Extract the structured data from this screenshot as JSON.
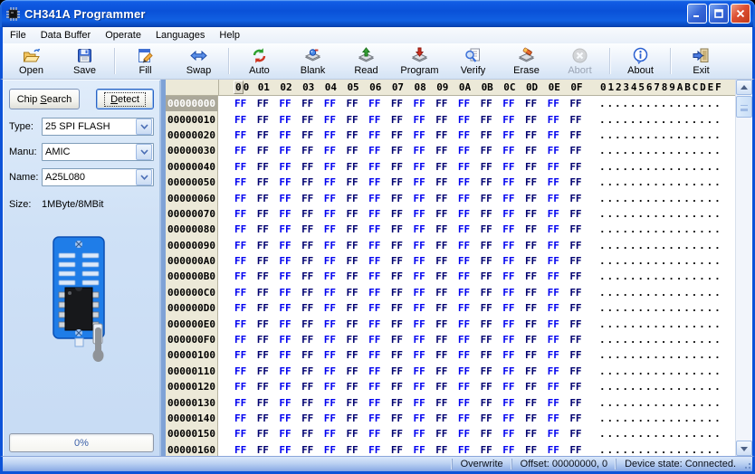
{
  "window": {
    "title": "CH341A Programmer"
  },
  "menu": {
    "items": [
      "File",
      "Data Buffer",
      "Operate",
      "Languages",
      "Help"
    ]
  },
  "toolbar": {
    "buttons": [
      {
        "label": "Open",
        "icon": "open-icon",
        "enabled": true,
        "group_end": false
      },
      {
        "label": "Save",
        "icon": "save-icon",
        "enabled": true,
        "group_end": true
      },
      {
        "label": "Fill",
        "icon": "fill-icon",
        "enabled": true,
        "group_end": false
      },
      {
        "label": "Swap",
        "icon": "swap-icon",
        "enabled": true,
        "group_end": true
      },
      {
        "label": "Auto",
        "icon": "auto-icon",
        "enabled": true,
        "group_end": false
      },
      {
        "label": "Blank",
        "icon": "blank-icon",
        "enabled": true,
        "group_end": false
      },
      {
        "label": "Read",
        "icon": "read-icon",
        "enabled": true,
        "group_end": false
      },
      {
        "label": "Program",
        "icon": "program-icon",
        "enabled": true,
        "group_end": false
      },
      {
        "label": "Verify",
        "icon": "verify-icon",
        "enabled": true,
        "group_end": false
      },
      {
        "label": "Erase",
        "icon": "erase-icon",
        "enabled": true,
        "group_end": false
      },
      {
        "label": "Abort",
        "icon": "abort-icon",
        "enabled": false,
        "group_end": true
      },
      {
        "label": "About",
        "icon": "about-icon",
        "enabled": true,
        "group_end": true
      },
      {
        "label": "Exit",
        "icon": "exit-icon",
        "enabled": true,
        "group_end": false
      }
    ]
  },
  "left_panel": {
    "chip_search_button": "Chip Search",
    "chip_search_accel": "S",
    "detect_button": "Detect",
    "detect_accel": "D",
    "fields": [
      {
        "label": "Type:",
        "value": "25 SPI FLASH"
      },
      {
        "label": "Manu:",
        "value": "AMIC"
      },
      {
        "label": "Name:",
        "value": "A25L080"
      }
    ],
    "size_label": "Size:",
    "size_value": "1MByte/8MBit",
    "progress": "0%"
  },
  "hex_editor": {
    "column_headers": [
      "00",
      "01",
      "02",
      "03",
      "04",
      "05",
      "06",
      "07",
      "08",
      "09",
      "0A",
      "0B",
      "0C",
      "0D",
      "0E",
      "0F"
    ],
    "ascii_header": "0123456789ABCDEF",
    "rows": [
      {
        "addr": "00000000",
        "selected": true,
        "bytes": [
          "FF",
          "FF",
          "FF",
          "FF",
          "FF",
          "FF",
          "FF",
          "FF",
          "FF",
          "FF",
          "FF",
          "FF",
          "FF",
          "FF",
          "FF",
          "FF"
        ],
        "ascii": "................"
      },
      {
        "addr": "00000010",
        "selected": false,
        "bytes": [
          "FF",
          "FF",
          "FF",
          "FF",
          "FF",
          "FF",
          "FF",
          "FF",
          "FF",
          "FF",
          "FF",
          "FF",
          "FF",
          "FF",
          "FF",
          "FF"
        ],
        "ascii": "................"
      },
      {
        "addr": "00000020",
        "selected": false,
        "bytes": [
          "FF",
          "FF",
          "FF",
          "FF",
          "FF",
          "FF",
          "FF",
          "FF",
          "FF",
          "FF",
          "FF",
          "FF",
          "FF",
          "FF",
          "FF",
          "FF"
        ],
        "ascii": "................"
      },
      {
        "addr": "00000030",
        "selected": false,
        "bytes": [
          "FF",
          "FF",
          "FF",
          "FF",
          "FF",
          "FF",
          "FF",
          "FF",
          "FF",
          "FF",
          "FF",
          "FF",
          "FF",
          "FF",
          "FF",
          "FF"
        ],
        "ascii": "................"
      },
      {
        "addr": "00000040",
        "selected": false,
        "bytes": [
          "FF",
          "FF",
          "FF",
          "FF",
          "FF",
          "FF",
          "FF",
          "FF",
          "FF",
          "FF",
          "FF",
          "FF",
          "FF",
          "FF",
          "FF",
          "FF"
        ],
        "ascii": "................"
      },
      {
        "addr": "00000050",
        "selected": false,
        "bytes": [
          "FF",
          "FF",
          "FF",
          "FF",
          "FF",
          "FF",
          "FF",
          "FF",
          "FF",
          "FF",
          "FF",
          "FF",
          "FF",
          "FF",
          "FF",
          "FF"
        ],
        "ascii": "................"
      },
      {
        "addr": "00000060",
        "selected": false,
        "bytes": [
          "FF",
          "FF",
          "FF",
          "FF",
          "FF",
          "FF",
          "FF",
          "FF",
          "FF",
          "FF",
          "FF",
          "FF",
          "FF",
          "FF",
          "FF",
          "FF"
        ],
        "ascii": "................"
      },
      {
        "addr": "00000070",
        "selected": false,
        "bytes": [
          "FF",
          "FF",
          "FF",
          "FF",
          "FF",
          "FF",
          "FF",
          "FF",
          "FF",
          "FF",
          "FF",
          "FF",
          "FF",
          "FF",
          "FF",
          "FF"
        ],
        "ascii": "................"
      },
      {
        "addr": "00000080",
        "selected": false,
        "bytes": [
          "FF",
          "FF",
          "FF",
          "FF",
          "FF",
          "FF",
          "FF",
          "FF",
          "FF",
          "FF",
          "FF",
          "FF",
          "FF",
          "FF",
          "FF",
          "FF"
        ],
        "ascii": "................"
      },
      {
        "addr": "00000090",
        "selected": false,
        "bytes": [
          "FF",
          "FF",
          "FF",
          "FF",
          "FF",
          "FF",
          "FF",
          "FF",
          "FF",
          "FF",
          "FF",
          "FF",
          "FF",
          "FF",
          "FF",
          "FF"
        ],
        "ascii": "................"
      },
      {
        "addr": "000000A0",
        "selected": false,
        "bytes": [
          "FF",
          "FF",
          "FF",
          "FF",
          "FF",
          "FF",
          "FF",
          "FF",
          "FF",
          "FF",
          "FF",
          "FF",
          "FF",
          "FF",
          "FF",
          "FF"
        ],
        "ascii": "................"
      },
      {
        "addr": "000000B0",
        "selected": false,
        "bytes": [
          "FF",
          "FF",
          "FF",
          "FF",
          "FF",
          "FF",
          "FF",
          "FF",
          "FF",
          "FF",
          "FF",
          "FF",
          "FF",
          "FF",
          "FF",
          "FF"
        ],
        "ascii": "................"
      },
      {
        "addr": "000000C0",
        "selected": false,
        "bytes": [
          "FF",
          "FF",
          "FF",
          "FF",
          "FF",
          "FF",
          "FF",
          "FF",
          "FF",
          "FF",
          "FF",
          "FF",
          "FF",
          "FF",
          "FF",
          "FF"
        ],
        "ascii": "................"
      },
      {
        "addr": "000000D0",
        "selected": false,
        "bytes": [
          "FF",
          "FF",
          "FF",
          "FF",
          "FF",
          "FF",
          "FF",
          "FF",
          "FF",
          "FF",
          "FF",
          "FF",
          "FF",
          "FF",
          "FF",
          "FF"
        ],
        "ascii": "................"
      },
      {
        "addr": "000000E0",
        "selected": false,
        "bytes": [
          "FF",
          "FF",
          "FF",
          "FF",
          "FF",
          "FF",
          "FF",
          "FF",
          "FF",
          "FF",
          "FF",
          "FF",
          "FF",
          "FF",
          "FF",
          "FF"
        ],
        "ascii": "................"
      },
      {
        "addr": "000000F0",
        "selected": false,
        "bytes": [
          "FF",
          "FF",
          "FF",
          "FF",
          "FF",
          "FF",
          "FF",
          "FF",
          "FF",
          "FF",
          "FF",
          "FF",
          "FF",
          "FF",
          "FF",
          "FF"
        ],
        "ascii": "................"
      },
      {
        "addr": "00000100",
        "selected": false,
        "bytes": [
          "FF",
          "FF",
          "FF",
          "FF",
          "FF",
          "FF",
          "FF",
          "FF",
          "FF",
          "FF",
          "FF",
          "FF",
          "FF",
          "FF",
          "FF",
          "FF"
        ],
        "ascii": "................"
      },
      {
        "addr": "00000110",
        "selected": false,
        "bytes": [
          "FF",
          "FF",
          "FF",
          "FF",
          "FF",
          "FF",
          "FF",
          "FF",
          "FF",
          "FF",
          "FF",
          "FF",
          "FF",
          "FF",
          "FF",
          "FF"
        ],
        "ascii": "................"
      },
      {
        "addr": "00000120",
        "selected": false,
        "bytes": [
          "FF",
          "FF",
          "FF",
          "FF",
          "FF",
          "FF",
          "FF",
          "FF",
          "FF",
          "FF",
          "FF",
          "FF",
          "FF",
          "FF",
          "FF",
          "FF"
        ],
        "ascii": "................"
      },
      {
        "addr": "00000130",
        "selected": false,
        "bytes": [
          "FF",
          "FF",
          "FF",
          "FF",
          "FF",
          "FF",
          "FF",
          "FF",
          "FF",
          "FF",
          "FF",
          "FF",
          "FF",
          "FF",
          "FF",
          "FF"
        ],
        "ascii": "................"
      },
      {
        "addr": "00000140",
        "selected": false,
        "bytes": [
          "FF",
          "FF",
          "FF",
          "FF",
          "FF",
          "FF",
          "FF",
          "FF",
          "FF",
          "FF",
          "FF",
          "FF",
          "FF",
          "FF",
          "FF",
          "FF"
        ],
        "ascii": "................"
      },
      {
        "addr": "00000150",
        "selected": false,
        "bytes": [
          "FF",
          "FF",
          "FF",
          "FF",
          "FF",
          "FF",
          "FF",
          "FF",
          "FF",
          "FF",
          "FF",
          "FF",
          "FF",
          "FF",
          "FF",
          "FF"
        ],
        "ascii": "................"
      },
      {
        "addr": "00000160",
        "selected": false,
        "bytes": [
          "FF",
          "FF",
          "FF",
          "FF",
          "FF",
          "FF",
          "FF",
          "FF",
          "FF",
          "FF",
          "FF",
          "FF",
          "FF",
          "FF",
          "FF",
          "FF"
        ],
        "ascii": "................"
      }
    ]
  },
  "status_bar": {
    "mode": "Overwrite",
    "offset": "Offset: 00000000, 0",
    "device_state": "Device state: Connected."
  },
  "colors": {
    "byte_even": "#0000f0",
    "byte_odd": "#000070",
    "titlebar_blue": "#0a51d8",
    "selected_addr_bg": "#aba89a",
    "gutter_bg": "#ece9d8"
  }
}
